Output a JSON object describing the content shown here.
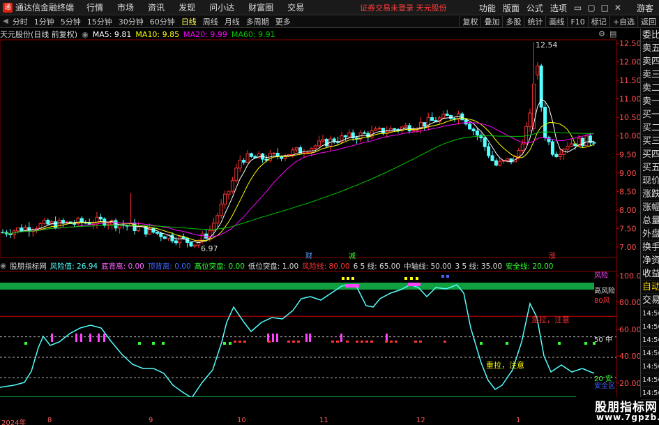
{
  "titlebar": {
    "app_title": "通达信金融终端",
    "menu": [
      "行情",
      "市场",
      "资讯",
      "发现",
      "问小达",
      "财富圈",
      "交易"
    ],
    "notice": "证券交易未登录  天元股份",
    "right_buttons": [
      "功能",
      "版面",
      "公式",
      "选项"
    ],
    "guest": "游客"
  },
  "periodbar": {
    "periods": [
      "分时",
      "1分钟",
      "5分钟",
      "15分钟",
      "30分钟",
      "60分钟",
      "日线",
      "周线",
      "月线",
      "多周期",
      "更多"
    ],
    "active": "日线",
    "tools": [
      "复权",
      "叠加",
      "多股",
      "统计",
      "画线",
      "F10",
      "标记",
      "+自选",
      "返回"
    ]
  },
  "stock": {
    "name": "天元股份(日线 前复权)",
    "ma5": "MA5: 9.81",
    "ma10": "MA10: 9.85",
    "ma20": "MA20: 9.99",
    "ma60": "MA60: 9.91",
    "high_label": "12.54",
    "low_label": "6.97",
    "event_cai": "财",
    "event_jian": "减",
    "event_zhang": "涨"
  },
  "price_axis": [
    "12.50",
    "12.00",
    "11.50",
    "11.00",
    "10.50",
    "10.00",
    "9.50",
    "9.00",
    "8.50",
    "8.00",
    "7.50",
    "7.00"
  ],
  "indicator": {
    "name": "股朋指标网",
    "risk": "风险值: 26.94",
    "bottom": "底背离: 0.00",
    "top": "顶背离: 0.00",
    "high_break": "高位突盘: 0.00",
    "low_break": "低位突盘: 1.00",
    "risk_line": "风险线: 80.00",
    "l65": "6 5 线: 65.00",
    "mid": "中轴线: 50.00",
    "l35": "3 5 线: 35.00",
    "safe": "安全线: 20.00",
    "axis": [
      "100.0",
      "80.00",
      "60.00",
      "40.00",
      "20.00"
    ],
    "label_high": "高风险",
    "label_fengxian": "风险",
    "label_80": "80风",
    "label_50": "50 中",
    "label_20": "20 安",
    "label_safe_zone": "安全区",
    "note_top": "急拉，注意",
    "note_bottom": "重拉，注意"
  },
  "date_axis": [
    "2024年",
    "8",
    "9",
    "10",
    "11",
    "12",
    "1"
  ],
  "sidebar": {
    "items": [
      "委比",
      "卖五",
      "卖四",
      "卖三",
      "卖二",
      "卖一",
      "买一",
      "买二",
      "买三",
      "买四",
      "买五",
      "现价",
      "涨跌",
      "涨幅",
      "总量",
      "外盘",
      "换手",
      "净资",
      "收益",
      "自动",
      "交易"
    ],
    "times": [
      "14:56",
      "14:56",
      "14:56",
      "14:56",
      "14:56",
      "14:56",
      "14:56",
      "14:56",
      "14:56",
      "14:56"
    ]
  },
  "watermark": {
    "big": "股朋指标网",
    "small": "www.7gpzb.com"
  },
  "colors": {
    "up": "#ff3232",
    "down": "#54ffff",
    "ma5": "#ffffff",
    "ma10": "#ffff00",
    "ma20": "#ff00ff",
    "ma60": "#00c800"
  }
}
